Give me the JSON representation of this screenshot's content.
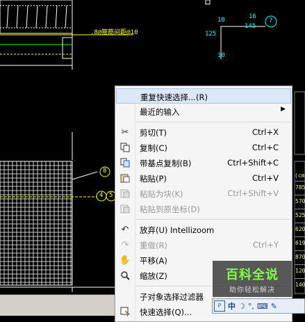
{
  "drawing": {
    "label_dia": ".8@箍筋间距@10",
    "dim_16": "16",
    "dim_145": "145",
    "dim_10_top": "10",
    "dim_125": "125",
    "dim_10_bottom": "10",
    "callout_7": "7",
    "callout_8": "8",
    "callout_4": "4",
    "callout_5": "5",
    "table_values": [
      "785",
      "570",
      "525",
      "620",
      "619",
      "870",
      "120",
      "140"
    ],
    "table_header": "(cm)"
  },
  "menu": {
    "items": [
      {
        "label": "重复快速选择...(R)",
        "shortcut": "",
        "icon": "",
        "disabled": false,
        "highlight": true
      },
      {
        "label": "最近的输入",
        "shortcut": "",
        "icon": "",
        "submenu": true
      },
      {
        "label": "剪切(T)",
        "shortcut": "Ctrl+X",
        "icon": "scissors-icon"
      },
      {
        "label": "复制(C)",
        "shortcut": "Ctrl+C",
        "icon": "copy-icon"
      },
      {
        "label": "带基点复制(B)",
        "shortcut": "Ctrl+Shift+C",
        "icon": "copy-base-icon"
      },
      {
        "label": "粘贴(P)",
        "shortcut": "Ctrl+V",
        "icon": "paste-icon"
      },
      {
        "label": "粘贴为块(K)",
        "shortcut": "Ctrl+Shift+V",
        "icon": "paste-block-icon",
        "disabled": true
      },
      {
        "label": "粘贴到原坐标(D)",
        "shortcut": "",
        "icon": "paste-orig-icon",
        "disabled": true
      },
      {
        "label": "放弃(U) Intellizoom",
        "shortcut": "",
        "icon": "undo-icon"
      },
      {
        "label": "重做(R)",
        "shortcut": "Ctrl+Y",
        "icon": "redo-icon",
        "disabled": true
      },
      {
        "label": "平移(A)",
        "shortcut": "",
        "icon": "pan-icon"
      },
      {
        "label": "缩放(Z)",
        "shortcut": "",
        "icon": "zoom-icon"
      },
      {
        "label": "子对象选择过滤器",
        "shortcut": "",
        "icon": ""
      },
      {
        "label": "快速选择(Q)...",
        "shortcut": "",
        "icon": "quick-select-icon"
      }
    ]
  },
  "watermark": {
    "title": "百科全说",
    "subtitle": "助你轻松解决"
  },
  "ime": {
    "lang": "中",
    "moon": "☽",
    "dot": "°,",
    "kbd": "⌨",
    "hint": "✎"
  }
}
